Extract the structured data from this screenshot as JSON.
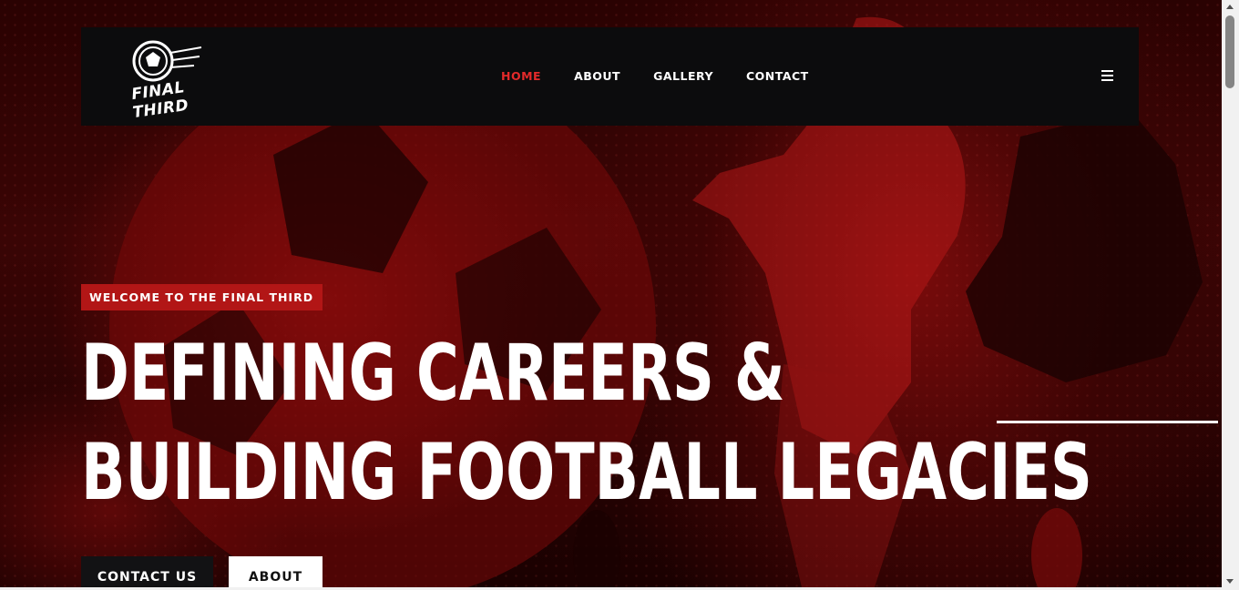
{
  "brand": {
    "logo_text": "FINAL THIRD"
  },
  "nav": {
    "links": [
      {
        "label": "HOME",
        "active": true
      },
      {
        "label": "ABOUT",
        "active": false
      },
      {
        "label": "GALLERY",
        "active": false
      },
      {
        "label": "CONTACT",
        "active": false
      }
    ],
    "menu_icon": "hamburger-icon"
  },
  "hero": {
    "badge": "WELCOME TO THE FINAL THIRD",
    "headline_line1": "DEFINING CAREERS &",
    "headline_line2": "BUILDING FOOTBALL LEGACIES",
    "buttons": {
      "contact": "CONTACT US",
      "about": "ABOUT"
    }
  },
  "colors": {
    "accent": "#e42a2a",
    "badge": "#b21616",
    "nav_bg": "#0c0c0d"
  }
}
